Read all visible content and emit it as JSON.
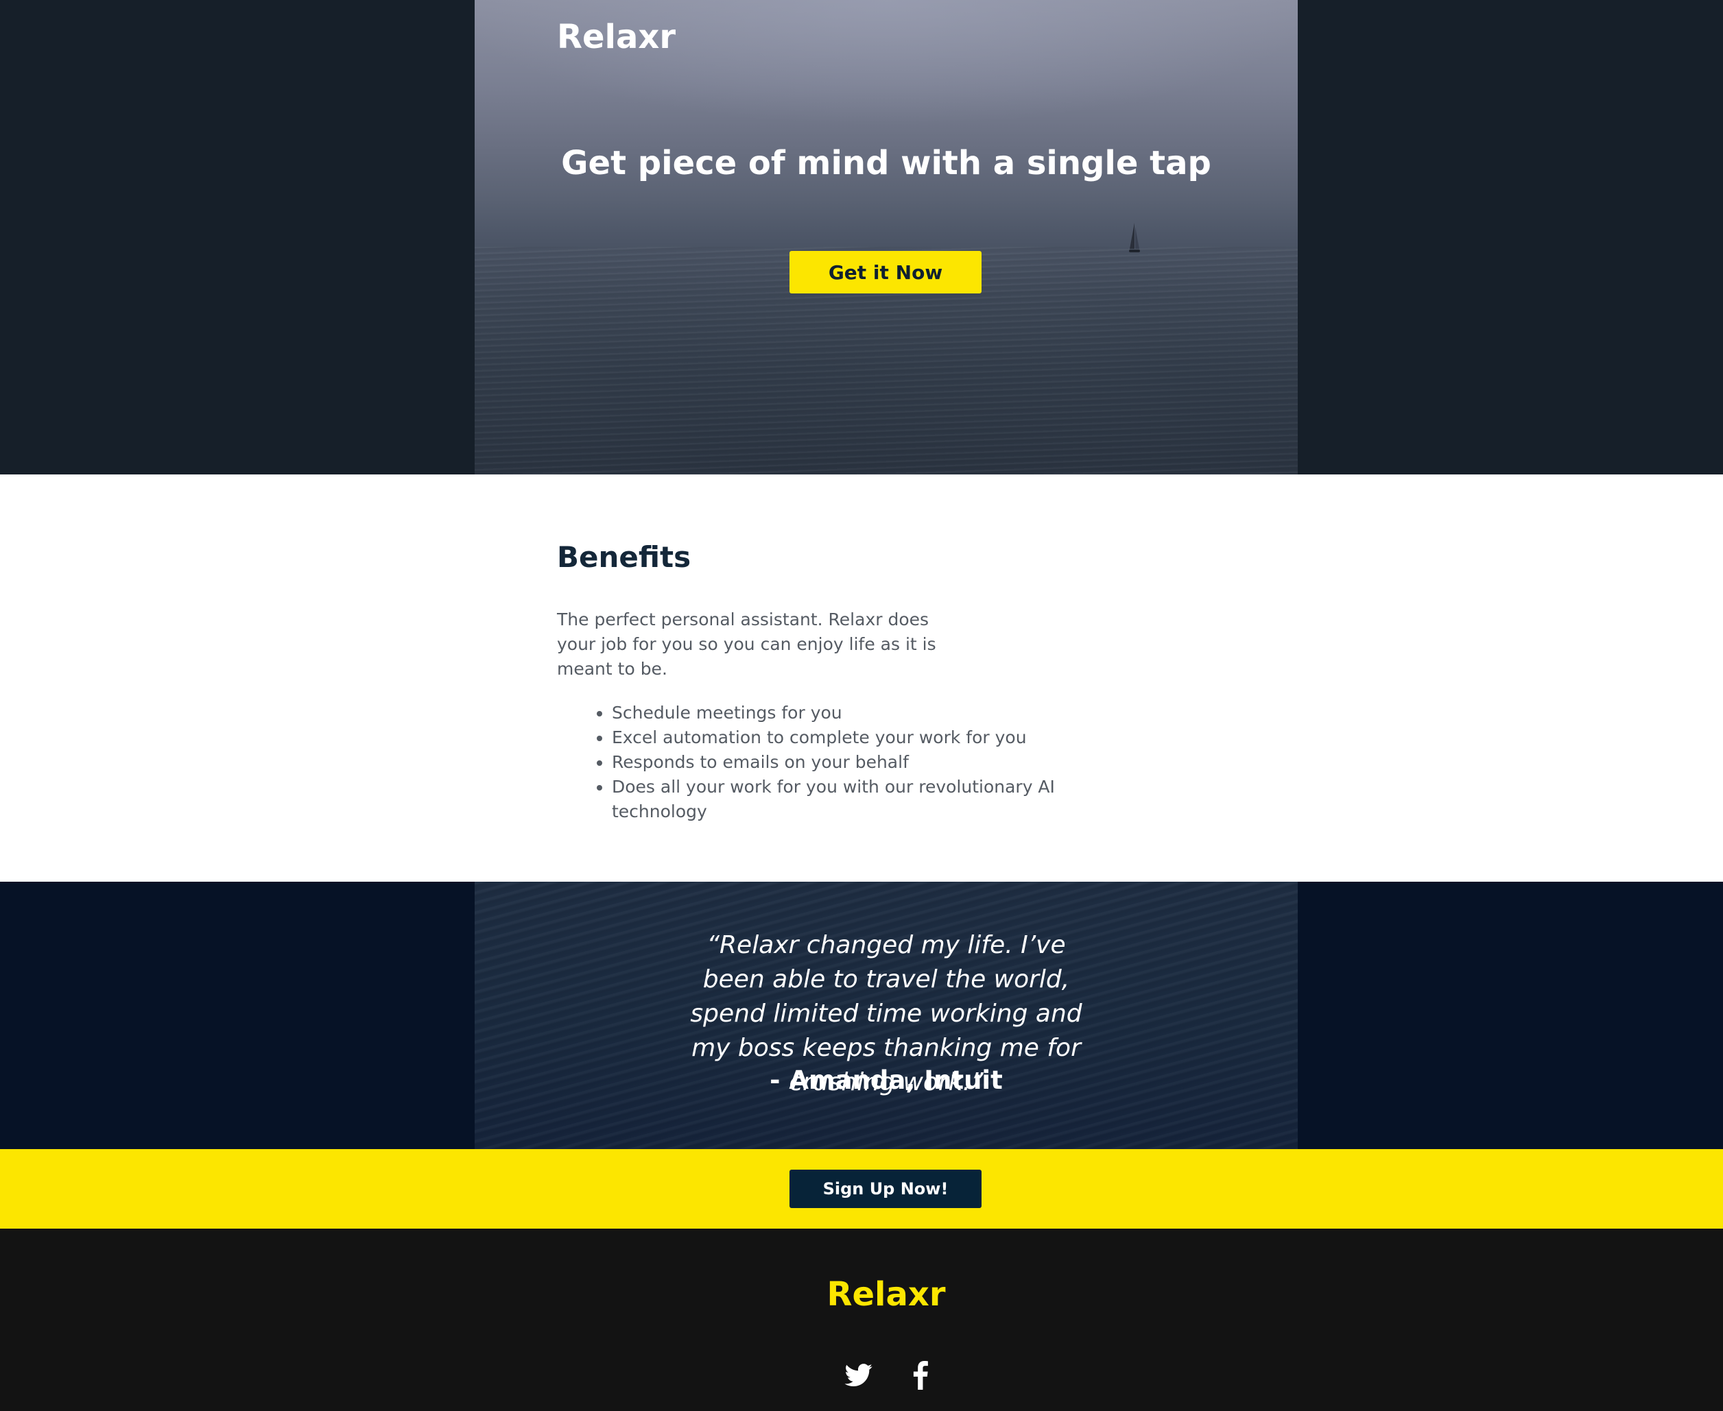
{
  "hero": {
    "brand": "Relaxr",
    "headline": "Get piece of mind with a single tap",
    "cta_label": "Get it Now"
  },
  "benefits": {
    "title": "Benefits",
    "description": "The perfect personal assistant. Relaxr does your job for you so you can enjoy life as it is meant to be.",
    "items": [
      "Schedule meetings for you",
      "Excel automation to complete your work for you",
      "Responds to emails on your behalf",
      "Does all your work for you with our revolutionary AI technology"
    ]
  },
  "testimonial": {
    "quote": "“Relaxr changed my life. I’ve been able to travel the world, spend limited time working and my boss keeps thanking me for crushing work.”",
    "author": "- Amanda, Intuit"
  },
  "signup": {
    "cta_label": "Sign Up Now!"
  },
  "footer": {
    "brand": "Relaxr",
    "social": [
      "twitter-icon",
      "facebook-icon"
    ]
  },
  "colors": {
    "accent_yellow": "#fce600",
    "navy": "#072338",
    "heading_dark": "#142739",
    "body_text": "#555b63",
    "footer_bg": "#131313",
    "testimonial_bg": "#061226"
  }
}
